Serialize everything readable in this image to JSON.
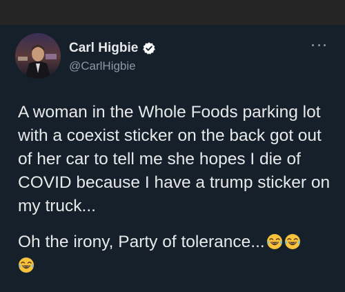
{
  "tweet": {
    "author_name": "Carl Higbie",
    "author_handle": "@CarlHigbie",
    "verified": true,
    "paragraph_1": "A woman in the Whole Foods parking lot with a coexist sticker on the back got out of her car to tell me she hopes I die of COVID because I have a trump sticker on my truck...",
    "paragraph_2": "Oh the irony, Party of tolerance...",
    "emoji_icon": "face-with-tears-of-joy-icon"
  },
  "colors": {
    "background": "#15202b",
    "top_bar": "#252525",
    "text_primary": "#e7e9ea",
    "text_secondary": "#8b98a5",
    "verified_badge": "#ffffff"
  }
}
